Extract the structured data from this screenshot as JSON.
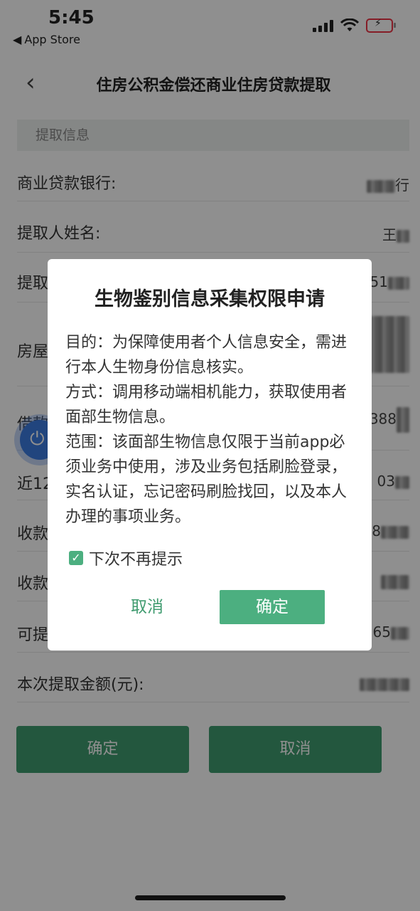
{
  "status_bar": {
    "time": "5:45",
    "back_app": "App Store",
    "back_icon": "back-triangle-icon"
  },
  "nav": {
    "back_icon": "chevron-left-icon",
    "title": "住房公积金偿还商业住房贷款提取"
  },
  "form": {
    "section_header": "提取信息",
    "rows": [
      {
        "label": "商业贷款银行:",
        "value_tail": "行"
      },
      {
        "label": "提取人姓名:",
        "value_tail": "王"
      },
      {
        "label": "提取",
        "value_tail": "51"
      },
      {
        "label": "房屋",
        "value_tail": ""
      },
      {
        "label": "借款",
        "value_tail": "388"
      },
      {
        "label": "近12",
        "value_tail": "03"
      },
      {
        "label": "收款",
        "value_tail": "8"
      },
      {
        "label": "收款",
        "value_tail": ""
      },
      {
        "label": "可提",
        "value_tail": "65"
      },
      {
        "label": "本次提取金额(元):",
        "value_tail": ""
      }
    ],
    "confirm_button": "确定",
    "cancel_button": "取消"
  },
  "dialog": {
    "title": "生物鉴别信息采集权限申请",
    "paragraphs": [
      "目的：为保障使用者个人信息安全，需进行本人生物身份信息核实。",
      "方式：调用移动端相机能力，获取使用者面部生物信息。",
      "范围：该面部生物信息仅限于当前app必须业务中使用，涉及业务包括刷脸登录，实名认证，忘记密码刷脸找回，以及本人办理的事项业务。"
    ],
    "checkbox_label": "下次不再提示",
    "checkbox_checked": true,
    "cancel": "取消",
    "confirm": "确定"
  },
  "colors": {
    "accent": "#4caf80",
    "button": "#3f9b6f",
    "overlay": "rgba(0,0,0,0.44)"
  }
}
